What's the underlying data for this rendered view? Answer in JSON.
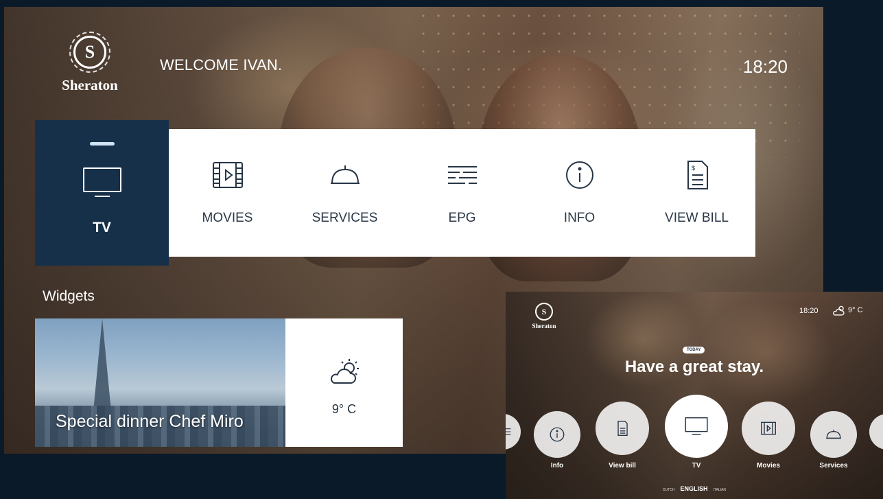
{
  "main": {
    "brand": "Sheraton",
    "brand_letter": "S",
    "welcome": "WELCOME IVAN.",
    "time": "18:20",
    "menu": {
      "tv": "TV",
      "movies": "MOVIES",
      "services": "SERVICES",
      "epg": "EPG",
      "info": "INFO",
      "view_bill": "VIEW BILL"
    },
    "widgets": {
      "title": "Widgets",
      "dinner_caption": "Special dinner Chef Miro",
      "weather_temp": "9° C",
      "weather_icon": "partly-cloudy-icon"
    },
    "colors": {
      "selected_tile": "#16304a",
      "menu_bg": "#ffffff",
      "page_bg": "#0b1a29"
    }
  },
  "inset": {
    "brand": "Sheraton",
    "brand_letter": "S",
    "time": "18:20",
    "weather_temp": "9° C",
    "today_badge": "TODAY",
    "headline": "Have a great stay.",
    "carousel": {
      "info": "Info",
      "view_bill": "View bill",
      "tv": "TV",
      "movies": "Movies",
      "services": "Services"
    },
    "languages": {
      "dutch": "DUTCH",
      "english": "ENGLISH",
      "italian": "ITALIAN"
    }
  }
}
